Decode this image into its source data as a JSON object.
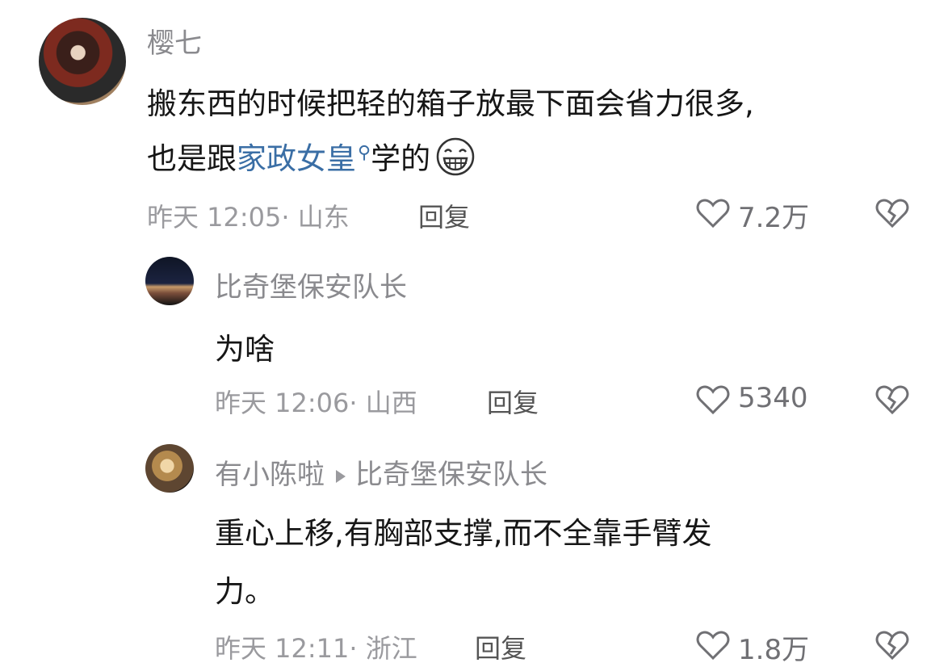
{
  "comments": [
    {
      "author": "樱七",
      "text_before_link": "搬东西的时候把轻的箱子放最下面会省力很多,",
      "text_line2_prefix": "也是跟",
      "link_text": "家政女皇",
      "link_icon": "search-icon",
      "text_line2_suffix": "学的",
      "emoji": "grinning-face-emoji",
      "time_location": "昨天 12:05· 山东",
      "reply_label": "回复",
      "likes": "7.2万"
    },
    {
      "author": "比奇堡保安队长",
      "text": "为啥",
      "time_location": "昨天 12:06· 山西",
      "reply_label": "回复",
      "likes": "5340"
    },
    {
      "author": "有小陈啦",
      "reply_to": "比奇堡保安队长",
      "text_line1": "重心上移,有胸部支撑,而不全靠手臂发",
      "text_line2": "力。",
      "time_location": "昨天 12:11· 浙江",
      "reply_label": "回复",
      "likes": "1.8万"
    }
  ]
}
